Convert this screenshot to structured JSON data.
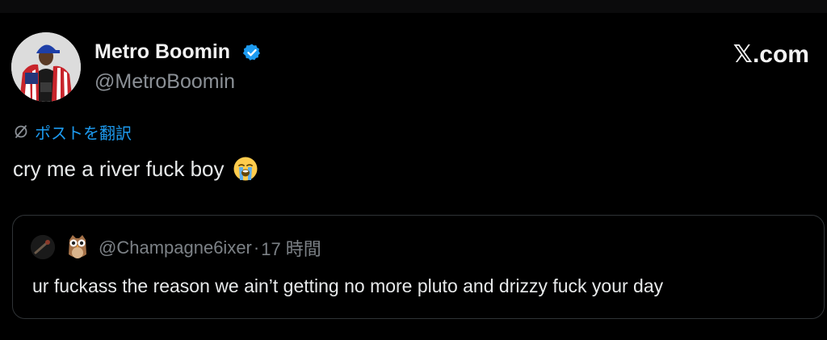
{
  "author": {
    "name": "Metro Boomin",
    "handle": "@MetroBoomin",
    "verified": true
  },
  "brand": {
    "logo_text": "𝕏.com"
  },
  "translate": {
    "label": "ポストを翻訳"
  },
  "post": {
    "text": "cry me a river fuck boy",
    "emoji": "loudly-crying-face"
  },
  "quote": {
    "handle": "@Champagne6ixer",
    "separator": "·",
    "time": "17 時間",
    "text": "ur fuckass the reason we ain’t getting no more pluto and drizzy fuck your day",
    "emoji_badge": "owl"
  },
  "colors": {
    "background": "#000000",
    "text": "#e7e9ea",
    "muted": "#8b9096",
    "accent": "#1d9bf0",
    "border": "#2f3336"
  }
}
